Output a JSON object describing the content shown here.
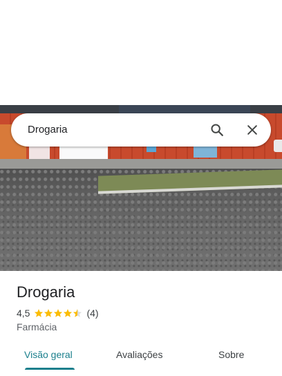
{
  "search": {
    "query": "Drogaria"
  },
  "place": {
    "name": "Drogaria",
    "rating": "4,5",
    "rating_value": 4.5,
    "review_count": "(4)",
    "category": "Farmácia"
  },
  "tabs": [
    {
      "label": "Visão geral",
      "active": true
    },
    {
      "label": "Avaliações",
      "active": false
    },
    {
      "label": "Sobre",
      "active": false
    }
  ],
  "colors": {
    "accent": "#1a7f8c",
    "star": "#fbbc04",
    "star_empty": "#dadce0"
  },
  "icons": {
    "search": "search-icon",
    "close": "close-icon",
    "star": "star-icon"
  }
}
